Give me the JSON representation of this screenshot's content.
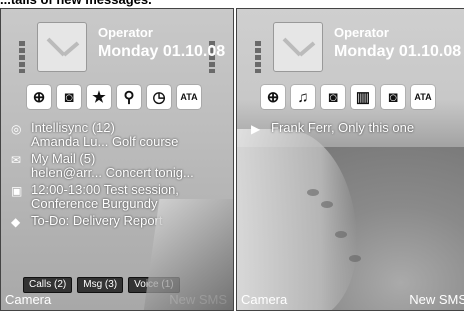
{
  "caption": "...tails of new messages.",
  "screen1": {
    "operator": "Operator",
    "date": "Monday 01.10.08",
    "icons": [
      "globe-icon",
      "folder-icon",
      "star-icon",
      "search-icon",
      "clock-icon",
      "ata-icon"
    ],
    "icon_glyphs": [
      "⊕",
      "◙",
      "★",
      "⚲",
      "◷",
      "ATA"
    ],
    "items": [
      {
        "icon": "sync-icon",
        "glyph": "◎",
        "line1": "Intellisync (12)",
        "line2": "Amanda Lu... Golf course"
      },
      {
        "icon": "mail-icon",
        "glyph": "✉",
        "line1": "My Mail (5)",
        "line2": "helen@arr... Concert tonig..."
      },
      {
        "icon": "calendar-icon",
        "glyph": "▣",
        "line1": "12:00-13:00 Test session,",
        "line2": "Conference Burgundy"
      },
      {
        "icon": "todo-icon",
        "glyph": "◆",
        "line1": "To-Do: Delivery Report",
        "line2": ""
      }
    ],
    "notifications": {
      "calls": "Calls (2)",
      "msg": "Msg (3)",
      "voice": "Voice (1)"
    },
    "softkey_left": "Camera",
    "softkey_right": "New SMS"
  },
  "screen2": {
    "operator": "Operator",
    "date": "Monday 01.10.08",
    "icons": [
      "globe-icon",
      "music-icon",
      "folder-icon",
      "calendar-icon",
      "contacts-icon",
      "ata-icon"
    ],
    "icon_glyphs": [
      "⊕",
      "♫",
      "◙",
      "▥",
      "◙",
      "ATA"
    ],
    "item": {
      "glyph": "▶",
      "text": "Frank Ferr, Only this one"
    },
    "softkey_left": "Camera",
    "softkey_right": "New SMS"
  }
}
